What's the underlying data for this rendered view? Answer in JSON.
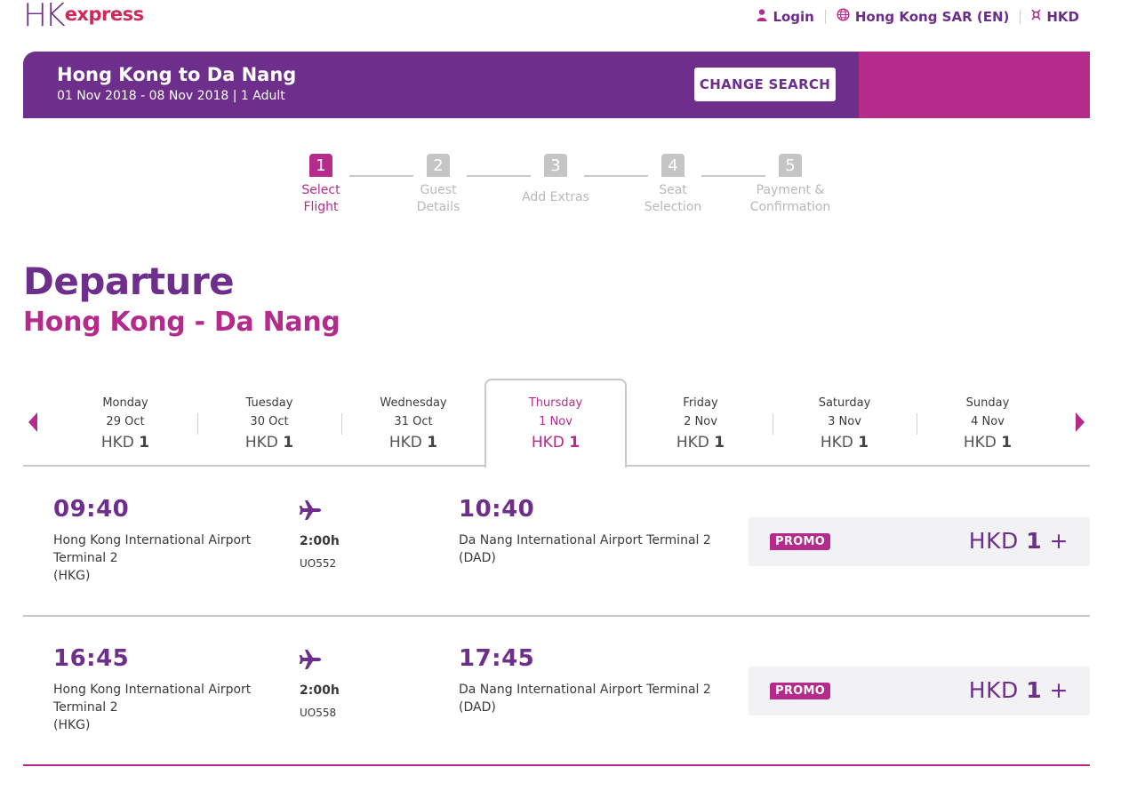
{
  "header": {
    "logo_hk": "HK",
    "logo_express": "express",
    "login_label": "Login",
    "region_label": "Hong Kong SAR (EN)",
    "currency_label": "HKD",
    "icons": {
      "login": "user-icon",
      "region": "globe-icon",
      "currency": "currency-icon"
    }
  },
  "search_banner": {
    "title": "Hong Kong to Da Nang",
    "subtitle": "01 Nov 2018 - 08 Nov 2018 | 1 Adult",
    "change_button": "CHANGE SEARCH"
  },
  "steps": [
    {
      "number": "1",
      "label_line1": "Select",
      "label_line2": "Flight",
      "active": true
    },
    {
      "number": "2",
      "label_line1": "Guest",
      "label_line2": "Details",
      "active": false
    },
    {
      "number": "3",
      "label_line1": "Add Extras",
      "label_line2": "",
      "active": false
    },
    {
      "number": "4",
      "label_line1": "Seat",
      "label_line2": "Selection",
      "active": false
    },
    {
      "number": "5",
      "label_line1": "Payment &",
      "label_line2": "Confirmation",
      "active": false
    }
  ],
  "section": {
    "title": "Departure",
    "route": "Hong Kong - Da Nang"
  },
  "dates": [
    {
      "day": "Monday",
      "date": "29 Oct",
      "currency": "HKD",
      "price": "1",
      "selected": false
    },
    {
      "day": "Tuesday",
      "date": "30 Oct",
      "currency": "HKD",
      "price": "1",
      "selected": false
    },
    {
      "day": "Wednesday",
      "date": "31 Oct",
      "currency": "HKD",
      "price": "1",
      "selected": false
    },
    {
      "day": "Thursday",
      "date": "1 Nov",
      "currency": "HKD",
      "price": "1",
      "selected": true
    },
    {
      "day": "Friday",
      "date": "2 Nov",
      "currency": "HKD",
      "price": "1",
      "selected": false
    },
    {
      "day": "Saturday",
      "date": "3 Nov",
      "currency": "HKD",
      "price": "1",
      "selected": false
    },
    {
      "day": "Sunday",
      "date": "4 Nov",
      "currency": "HKD",
      "price": "1",
      "selected": false
    }
  ],
  "flights": [
    {
      "dep_time": "09:40",
      "dep_airport_line1": "Hong Kong International Airport",
      "dep_airport_line2": "Terminal 2",
      "dep_code": "(HKG)",
      "duration": "2:00h",
      "flight_no": "UO552",
      "arr_time": "10:40",
      "arr_airport_line1": "Da Nang International Airport Terminal 2",
      "arr_code": "(DAD)",
      "badge": "PROMO",
      "currency": "HKD",
      "price": "1",
      "suffix": "+"
    },
    {
      "dep_time": "16:45",
      "dep_airport_line1": "Hong Kong International Airport",
      "dep_airport_line2": "Terminal 2",
      "dep_code": "(HKG)",
      "duration": "2:00h",
      "flight_no": "UO558",
      "arr_time": "17:45",
      "arr_airport_line1": "Da Nang International Airport Terminal 2",
      "arr_code": "(DAD)",
      "badge": "PROMO",
      "currency": "HKD",
      "price": "1",
      "suffix": "+"
    }
  ],
  "colors": {
    "brand_purple": "#6e2f8c",
    "brand_magenta": "#b52b8c",
    "logo_red": "#d0285a",
    "inactive_gray": "#c5c5c5"
  }
}
